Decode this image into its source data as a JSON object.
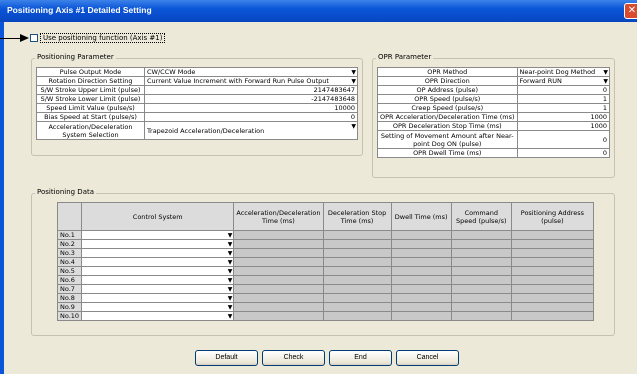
{
  "window": {
    "title": "Positioning Axis #1 Detailed Setting"
  },
  "use_checkbox": {
    "label": "Use positioning function (Axis #1)"
  },
  "positioning_parameter": {
    "legend": "Positioning Parameter",
    "rows": [
      {
        "label": "Pulse Output Mode",
        "value": "CW/CCW Mode",
        "type": "select"
      },
      {
        "label": "Rotation Direction Setting",
        "value": "Current Value Increment with Forward Run Pulse Output",
        "type": "select"
      },
      {
        "label": "S/W Stroke Upper Limit (pulse)",
        "value": "2147483647",
        "type": "num"
      },
      {
        "label": "S/W Stroke Lower Limit (pulse)",
        "value": "-2147483648",
        "type": "num"
      },
      {
        "label": "Speed Limit Value (pulse/s)",
        "value": "10000",
        "type": "num"
      },
      {
        "label": "Bias Speed at Start (pulse/s)",
        "value": "0",
        "type": "num"
      },
      {
        "label": "Acceleration/Deceleration System Selection",
        "value": "Trapezoid Acceleration/Deceleration",
        "type": "select"
      }
    ]
  },
  "opr_parameter": {
    "legend": "OPR Parameter",
    "rows": [
      {
        "label": "OPR Method",
        "value": "Near-point Dog Method",
        "type": "select"
      },
      {
        "label": "OPR Direction",
        "value": "Forward RUN",
        "type": "select"
      },
      {
        "label": "OP Address (pulse)",
        "value": "0",
        "type": "num"
      },
      {
        "label": "OPR Speed (pulse/s)",
        "value": "1",
        "type": "num"
      },
      {
        "label": "Creep Speed (pulse/s)",
        "value": "1",
        "type": "num"
      },
      {
        "label": "OPR Acceleration/Deceleration Time (ms)",
        "value": "1000",
        "type": "num"
      },
      {
        "label": "OPR Deceleration Stop Time (ms)",
        "value": "1000",
        "type": "num"
      },
      {
        "label": "Setting of Movement Amount after Near-point Dog ON (pulse)",
        "value": "0",
        "type": "num"
      },
      {
        "label": "OPR Dwell Time (ms)",
        "value": "0",
        "type": "num"
      }
    ]
  },
  "positioning_data": {
    "legend": "Positioning Data",
    "headers": [
      "Control System",
      "Acceleration/Deceleration Time (ms)",
      "Deceleration Stop Time (ms)",
      "Dwell Time (ms)",
      "Command Speed (pulse/s)",
      "Positioning Address (pulse)"
    ],
    "rows": [
      "No.1",
      "No.2",
      "No.3",
      "No.4",
      "No.5",
      "No.6",
      "No.7",
      "No.8",
      "No.9",
      "No.10"
    ]
  },
  "buttons": {
    "default": "Default",
    "check": "Check",
    "end": "End",
    "cancel": "Cancel"
  },
  "colors": {
    "titlebar": "#0a55d8",
    "dialog_bg": "#ece9d8",
    "grid_header": "#dcdcdc",
    "grid_cell": "#c8c8c8"
  }
}
